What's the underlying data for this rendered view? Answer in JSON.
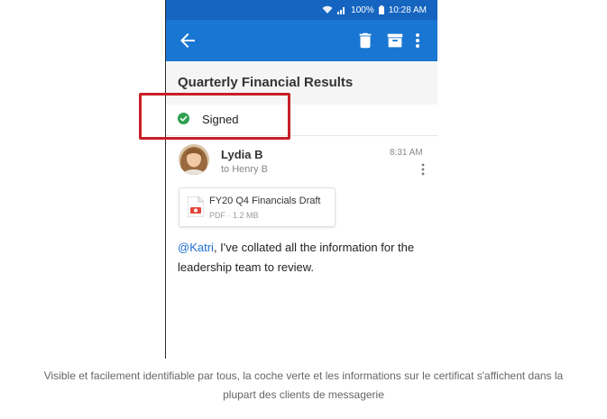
{
  "status_bar": {
    "battery": "100%",
    "time": "10:28 AM"
  },
  "toolbar": {
    "back_icon": "arrow-left-icon",
    "delete_icon": "trash-icon",
    "archive_icon": "archive-icon",
    "more_icon": "more-vertical-icon",
    "color": "#1976d2"
  },
  "message": {
    "subject": "Quarterly Financial Results",
    "signature": {
      "label": "Signed",
      "icon": "check-circle-icon",
      "color": "#2e9f4f"
    },
    "sender": "Lydia B",
    "recipient": "to Henry B",
    "time": "8:31 AM",
    "attachment": {
      "name": "FY20 Q4 Financials Draft",
      "meta": "PDF · 1.2 MB",
      "icon": "pdf-file-icon"
    },
    "mention": "@Katri",
    "body_line1": ", I've collated all the information for the",
    "body_line2": "leadership team to review."
  },
  "highlight_color": "#c62026",
  "caption": {
    "line1": "Visible et facilement identifiable par tous, la coche verte et les informations sur le certificat s'affichent dans la",
    "line2": "plupart des clients de messagerie"
  }
}
